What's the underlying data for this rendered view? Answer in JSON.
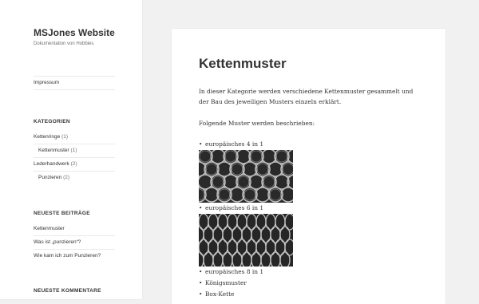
{
  "site": {
    "title": "MSJones Website",
    "description": "Dokumentation von Hobbies"
  },
  "sidebar": {
    "nav_link": "Impressum",
    "categories": {
      "heading": "KATEGORIEN",
      "items": [
        {
          "label": "Kettenringe",
          "count": "(1)",
          "child": false
        },
        {
          "label": "Kettenmuster",
          "count": "(1)",
          "child": true
        },
        {
          "label": "Lederhandwerk",
          "count": "(2)",
          "child": false
        },
        {
          "label": "Punzieren",
          "count": "(2)",
          "child": true
        }
      ]
    },
    "recent_posts": {
      "heading": "NEUESTE BEITRÄGE",
      "items": [
        "Kettenmuster",
        "Was ist „punzieren“?",
        "Wie kam ich zum Punzieren?"
      ]
    },
    "recent_comments": {
      "heading": "NEUESTE KOMMENTARE"
    }
  },
  "main": {
    "title": "Kettenmuster",
    "intro": "In dieser Kategorie werden verschiedene Kettenmuster gesammelt und der Bau des jeweiligen Musters einzeln erklärt.",
    "lead": "Folgende Muster werden beschrieben:",
    "patterns": [
      "europäisches 4 in 1",
      "europäisches 6 in 1",
      "europäisches 8 in 1",
      "Königsmuster",
      "Box-Kette"
    ]
  },
  "colors": {
    "background": "#f1f1f1",
    "panel": "#ffffff",
    "text": "#333333",
    "muted": "#707070"
  }
}
